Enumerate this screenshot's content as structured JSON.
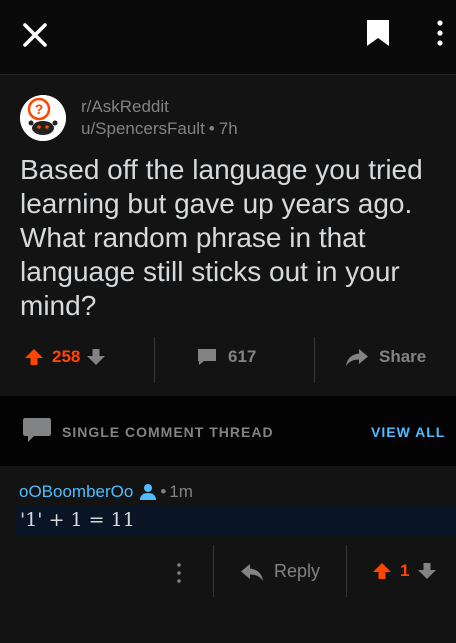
{
  "post": {
    "subreddit": "r/AskReddit",
    "author": "u/SpencersFault",
    "separator": "•",
    "age": "7h",
    "title": "Based off the language you tried learning but gave up years ago. What random phrase in that language still sticks out in your mind?",
    "score": "258",
    "comment_count": "617",
    "share_label": "Share"
  },
  "thread": {
    "label": "SINGLE COMMENT THREAD",
    "view_all": "VIEW ALL"
  },
  "comment": {
    "author": "oOBoomberOo",
    "separator": "•",
    "age": "1m",
    "body": "'1' + 1 = 11",
    "reply_label": "Reply",
    "score": "1"
  },
  "colors": {
    "background": "#131313",
    "upvote": "#ff4500",
    "link_blue": "#4fbcff",
    "muted": "#818384"
  },
  "icons": [
    "close-icon",
    "bookmark-icon",
    "more-vertical-icon",
    "subreddit-avatar",
    "upvote-arrow-icon",
    "downvote-arrow-icon",
    "comment-bubble-icon",
    "share-arrow-icon",
    "chat-icon",
    "op-user-icon",
    "reply-arrow-icon"
  ]
}
